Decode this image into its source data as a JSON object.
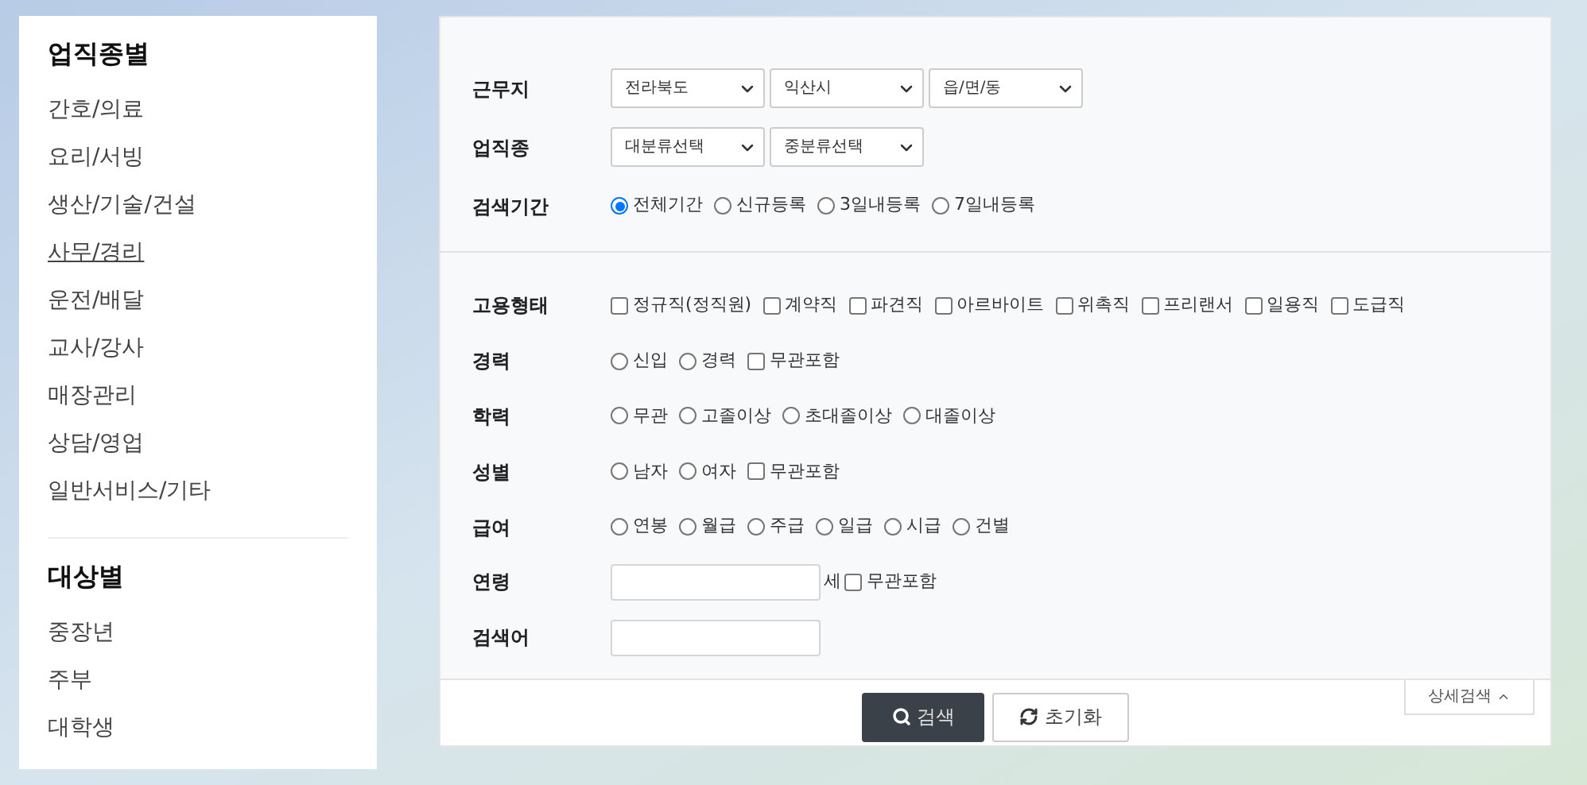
{
  "sidebar": {
    "sections": [
      {
        "title": "업직종별",
        "items": [
          {
            "label": "간호/의료",
            "selected": false
          },
          {
            "label": "요리/서빙",
            "selected": false
          },
          {
            "label": "생산/기술/건설",
            "selected": false
          },
          {
            "label": "사무/경리",
            "selected": true
          },
          {
            "label": "운전/배달",
            "selected": false
          },
          {
            "label": "교사/강사",
            "selected": false
          },
          {
            "label": "매장관리",
            "selected": false
          },
          {
            "label": "상담/영업",
            "selected": false
          },
          {
            "label": "일반서비스/기타",
            "selected": false
          }
        ]
      },
      {
        "title": "대상별",
        "items": [
          {
            "label": "중장년",
            "selected": false
          },
          {
            "label": "주부",
            "selected": false
          },
          {
            "label": "대학생",
            "selected": false
          }
        ]
      }
    ]
  },
  "form": {
    "sections": [
      {
        "rows": [
          {
            "label": "근무지",
            "kind": "selects",
            "selects": [
              {
                "value": "전라북도"
              },
              {
                "value": "익산시"
              },
              {
                "value": "읍/면/동"
              }
            ]
          },
          {
            "label": "업직종",
            "kind": "selects",
            "selects": [
              {
                "value": "대분류선택"
              },
              {
                "value": "중분류선택"
              }
            ]
          },
          {
            "label": "검색기간",
            "kind": "options",
            "options": [
              {
                "kind": "radio",
                "label": "전체기간",
                "selected": true
              },
              {
                "kind": "radio",
                "label": "신규등록",
                "selected": false
              },
              {
                "kind": "radio",
                "label": "3일내등록",
                "selected": false
              },
              {
                "kind": "radio",
                "label": "7일내등록",
                "selected": false
              }
            ]
          }
        ]
      },
      {
        "rows": [
          {
            "label": "고용형태",
            "kind": "options",
            "options": [
              {
                "kind": "checkbox",
                "label": "정규직(정직원)",
                "checked": false
              },
              {
                "kind": "checkbox",
                "label": "계약직",
                "checked": false
              },
              {
                "kind": "checkbox",
                "label": "파견직",
                "checked": false
              },
              {
                "kind": "checkbox",
                "label": "아르바이트",
                "checked": false
              },
              {
                "kind": "checkbox",
                "label": "위촉직",
                "checked": false
              },
              {
                "kind": "checkbox",
                "label": "프리랜서",
                "checked": false
              },
              {
                "kind": "checkbox",
                "label": "일용직",
                "checked": false
              },
              {
                "kind": "checkbox",
                "label": "도급직",
                "checked": false
              }
            ]
          },
          {
            "label": "경력",
            "kind": "options",
            "options": [
              {
                "kind": "radio",
                "label": "신입",
                "selected": false
              },
              {
                "kind": "radio",
                "label": "경력",
                "selected": false
              },
              {
                "kind": "checkbox",
                "label": "무관포함",
                "checked": false
              }
            ]
          },
          {
            "label": "학력",
            "kind": "options",
            "options": [
              {
                "kind": "radio",
                "label": "무관",
                "selected": false
              },
              {
                "kind": "radio",
                "label": "고졸이상",
                "selected": false
              },
              {
                "kind": "radio",
                "label": "초대졸이상",
                "selected": false
              },
              {
                "kind": "radio",
                "label": "대졸이상",
                "selected": false
              }
            ]
          },
          {
            "label": "성별",
            "kind": "options",
            "options": [
              {
                "kind": "radio",
                "label": "남자",
                "selected": false
              },
              {
                "kind": "radio",
                "label": "여자",
                "selected": false
              },
              {
                "kind": "checkbox",
                "label": "무관포함",
                "checked": false
              }
            ]
          },
          {
            "label": "급여",
            "kind": "options",
            "options": [
              {
                "kind": "radio",
                "label": "연봉",
                "selected": false
              },
              {
                "kind": "radio",
                "label": "월급",
                "selected": false
              },
              {
                "kind": "radio",
                "label": "주급",
                "selected": false
              },
              {
                "kind": "radio",
                "label": "일급",
                "selected": false
              },
              {
                "kind": "radio",
                "label": "시급",
                "selected": false
              },
              {
                "kind": "radio",
                "label": "건별",
                "selected": false
              }
            ]
          },
          {
            "label": "연령",
            "kind": "input",
            "suffix": "세",
            "options": [
              {
                "kind": "checkbox",
                "label": "무관포함",
                "checked": false
              }
            ]
          },
          {
            "label": "검색어",
            "kind": "input"
          }
        ]
      }
    ]
  },
  "buttons": [
    {
      "kind": "search",
      "label": "검색"
    },
    {
      "kind": "reset",
      "label": "초기화"
    }
  ],
  "toggle": {
    "label": "상세검색",
    "expanded": true
  }
}
